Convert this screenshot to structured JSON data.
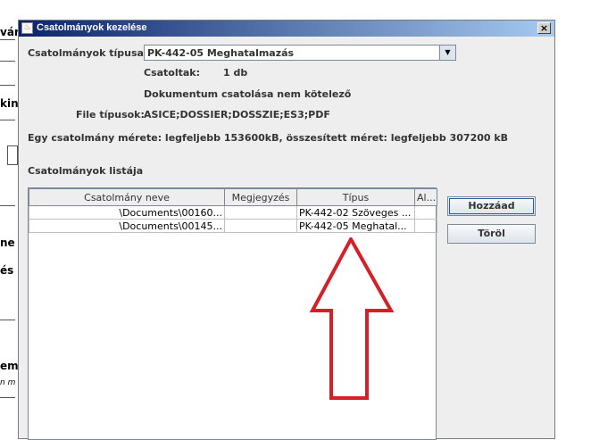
{
  "background_fragments": [
    "vár",
    "kin",
    "ne",
    "és",
    "em",
    "n m"
  ],
  "window": {
    "title": "Csatolmányok kezelése",
    "close_label": "×"
  },
  "form": {
    "type_label": "Csatolmányok típusa:",
    "type_value": "PK-442-05 Meghatalmazás",
    "attached_label": "Csatoltak:",
    "attached_value": "1 db",
    "optional_note": "Dokumentum csatolása nem kötelező",
    "file_types_label": "File típusok:",
    "file_types_value": "ASICE;DOSSIER;DOSSZIE;ES3;PDF",
    "size_note": "Egy csatolmány mérete: legfeljebb 153600kB, összesített méret: legfeljebb 307200 kB",
    "list_title": "Csatolmányok listája"
  },
  "table": {
    "columns": [
      "Csatolmány neve",
      "Megjegyzés",
      "Típus",
      "Al..."
    ],
    "rows": [
      [
        "\\Documents\\00160...",
        "",
        "PK-442-02 Szöveges ...",
        ""
      ],
      [
        "\\Documents\\00145...",
        "",
        "PK-442-05 Meghatal...",
        ""
      ]
    ]
  },
  "buttons": {
    "add": "Hozzáad",
    "delete": "Töröl"
  },
  "colors": {
    "annotation_arrow": "#d42027",
    "title_gradient_start": "#0a246a"
  }
}
